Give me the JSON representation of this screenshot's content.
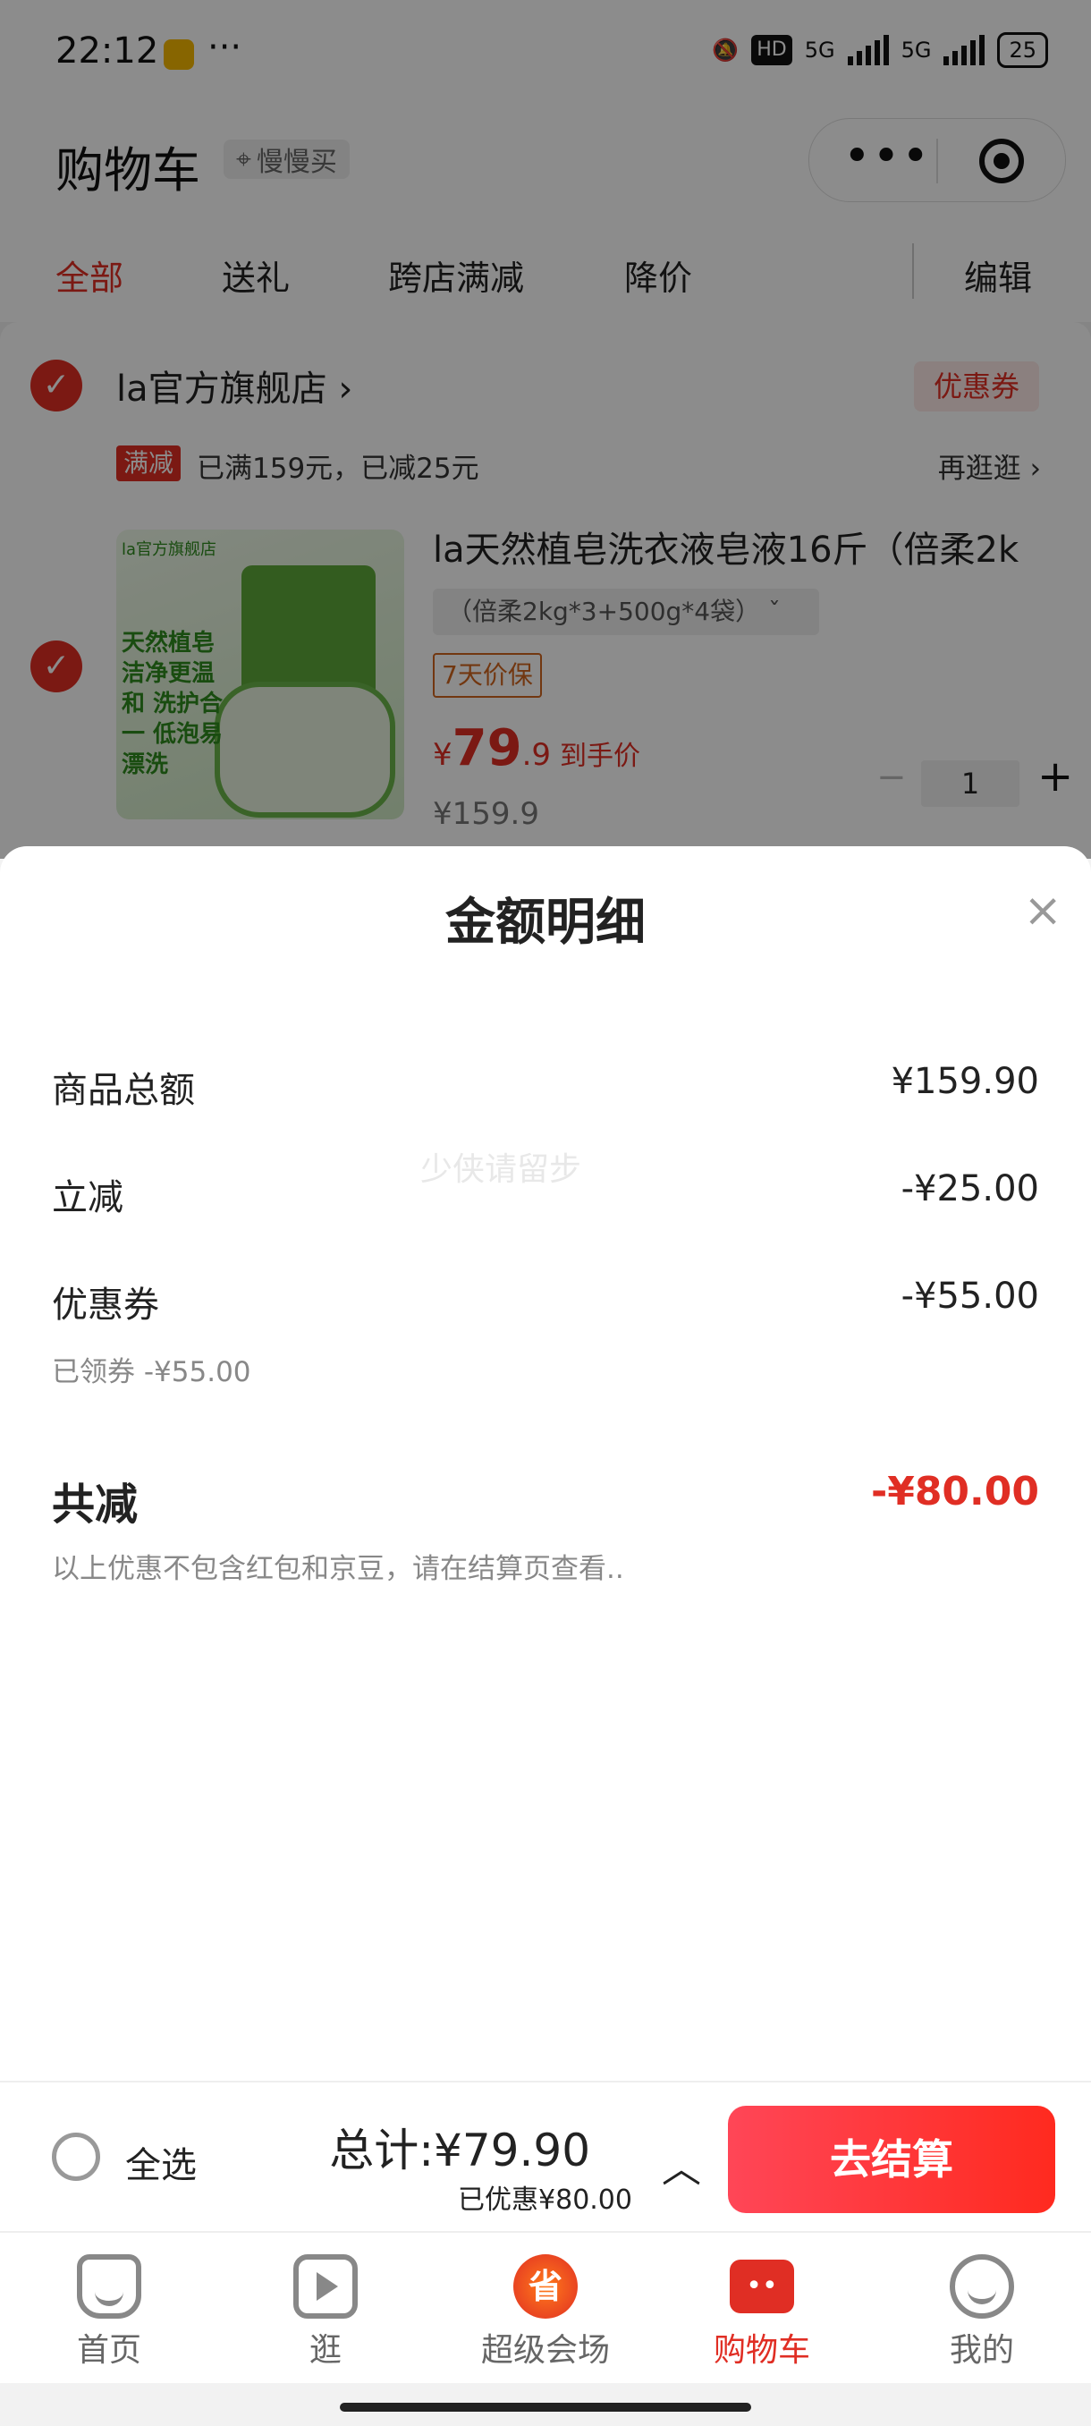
{
  "status_bar": {
    "time": "22:12",
    "dots": "···",
    "hd": "HD",
    "net1": "5G",
    "net2": "5G",
    "battery": "25"
  },
  "header": {
    "title": "购物车",
    "location": "慢慢买"
  },
  "tabs": [
    "全部",
    "送礼",
    "跨店满减",
    "降价",
    "编辑"
  ],
  "store": {
    "name": "la官方旗舰店 ›",
    "coupon_button": "优惠券",
    "promo_tag": "满减",
    "promo_text": "已满159元，已减25元",
    "revisit": "再逛逛 ›"
  },
  "product": {
    "image_text_top": "la官方旗舰店",
    "image_text": "天然植皂 洁净更温和 洗护合一 低泡易漂洗",
    "name": "la天然植皂洗衣液皂液16斤（倍柔2k",
    "spec": "（倍柔2kg*3+500g*4袋） ˇ",
    "guarantee": "7天价保",
    "price_symbol": "¥",
    "price_int": "79",
    "price_dec": ".9",
    "price_label": "到手价",
    "original_price": "¥159.9",
    "quantity": "1",
    "minus": "−",
    "plus": "+"
  },
  "sheet": {
    "title": "金额明细",
    "close": "×",
    "watermark": "少侠请留步",
    "rows": [
      {
        "label": "商品总额",
        "value": "¥159.90"
      },
      {
        "label": "立减",
        "value": "-¥25.00"
      },
      {
        "label": "优惠券",
        "value": "-¥55.00",
        "note": "已领券 -¥55.00"
      }
    ],
    "total_label": "共减",
    "total_value": "-¥80.00",
    "footnote": "以上优惠不包含红包和京豆，请在结算页查看.."
  },
  "checkout": {
    "select_all": "全选",
    "total": "总计:¥79.90",
    "saved": "已优惠¥80.00",
    "chevron": "︿",
    "pay_button": "去结算"
  },
  "tabbar": [
    {
      "label": "首页",
      "icon": "home-icon"
    },
    {
      "label": "逛",
      "icon": "play-icon"
    },
    {
      "label": "超级会场",
      "icon": "brand-icon",
      "glyph": "省"
    },
    {
      "label": "购物车",
      "icon": "cart-icon",
      "glyph": "••"
    },
    {
      "label": "我的",
      "icon": "face-icon"
    }
  ],
  "colors": {
    "accent": "#e02e24",
    "orange": "#d0651e"
  }
}
